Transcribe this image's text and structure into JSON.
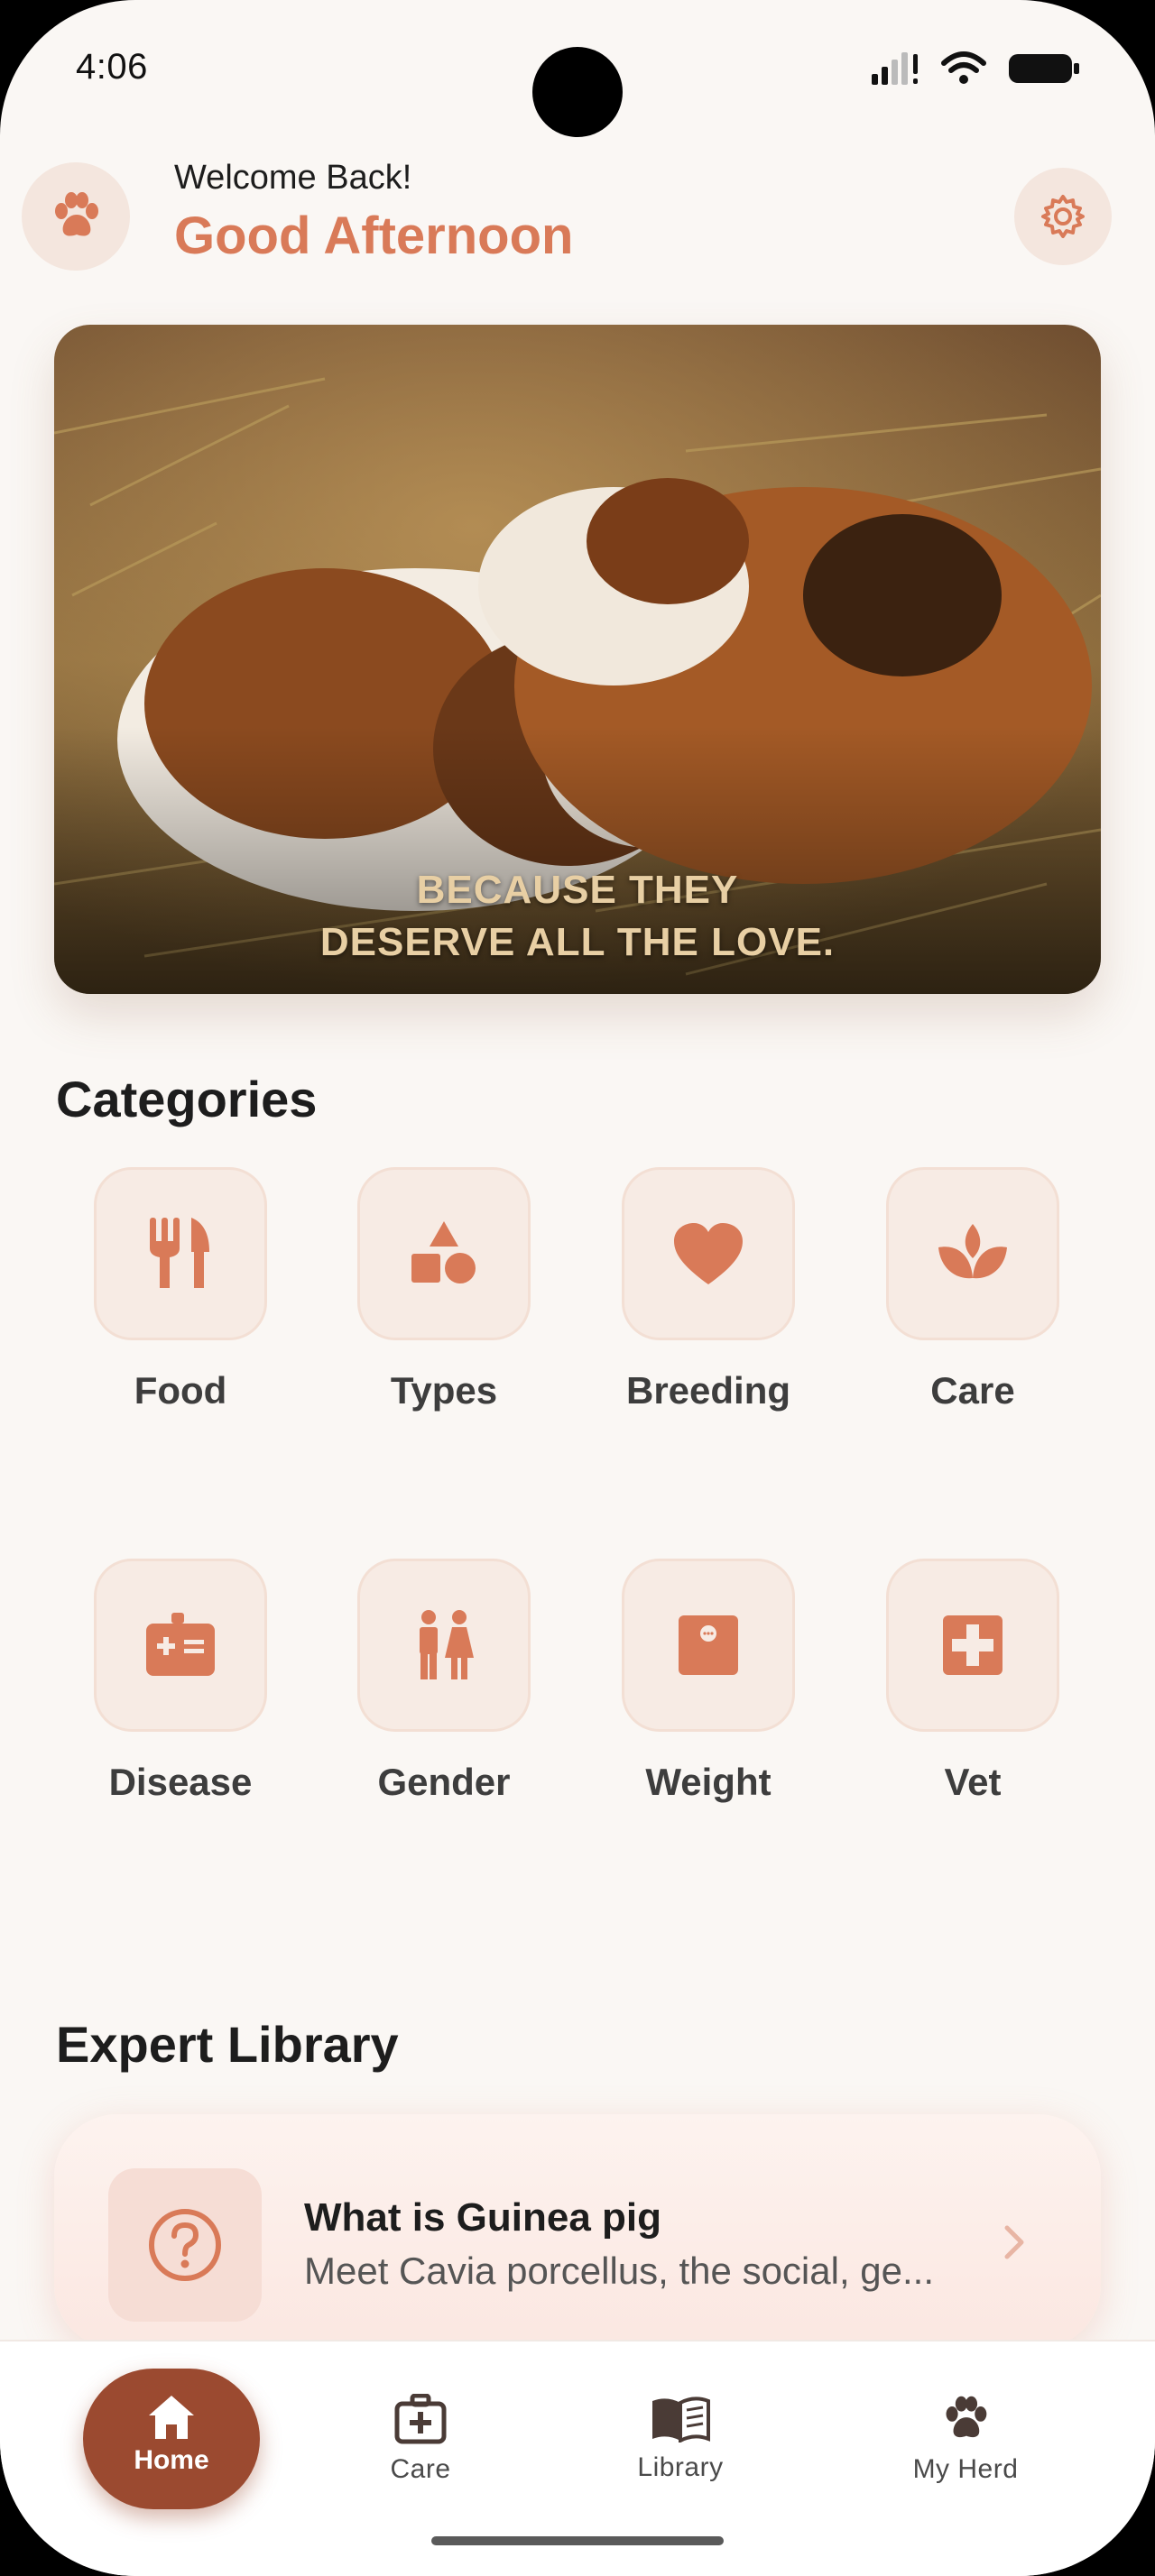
{
  "status_bar": {
    "time": "4:06"
  },
  "header": {
    "welcome": "Welcome Back!",
    "greeting": "Good Afternoon",
    "avatar_icon": "paw-icon",
    "settings_icon": "gear-icon"
  },
  "hero": {
    "caption_line1": "BECAUSE THEY",
    "caption_line2": "DESERVE ALL THE LOVE."
  },
  "categories": {
    "title": "Categories",
    "items": [
      {
        "label": "Food",
        "icon": "fork-knife-icon"
      },
      {
        "label": "Types",
        "icon": "shapes-icon"
      },
      {
        "label": "Breeding",
        "icon": "heart-icon"
      },
      {
        "label": "Care",
        "icon": "lotus-icon"
      },
      {
        "label": "Disease",
        "icon": "medical-kit-icon"
      },
      {
        "label": "Gender",
        "icon": "gender-icon"
      },
      {
        "label": "Weight",
        "icon": "scale-icon"
      },
      {
        "label": "Vet",
        "icon": "medical-cross-icon"
      }
    ]
  },
  "library": {
    "title": "Expert Library",
    "card": {
      "title": "What is Guinea pig",
      "subtitle": "Meet Cavia porcellus, the social, ge...",
      "icon": "question-circle-icon"
    }
  },
  "tabbar": {
    "items": [
      {
        "label": "Home",
        "icon": "home-icon",
        "active": true
      },
      {
        "label": "Care",
        "icon": "first-aid-icon"
      },
      {
        "label": "Library",
        "icon": "book-icon"
      },
      {
        "label": "My Herd",
        "icon": "paw-icon"
      }
    ]
  },
  "colors": {
    "accent": "#d97a58",
    "accent_dark": "#9b4a30",
    "tile_bg": "#f7ebe4",
    "background": "#faf7f4"
  }
}
